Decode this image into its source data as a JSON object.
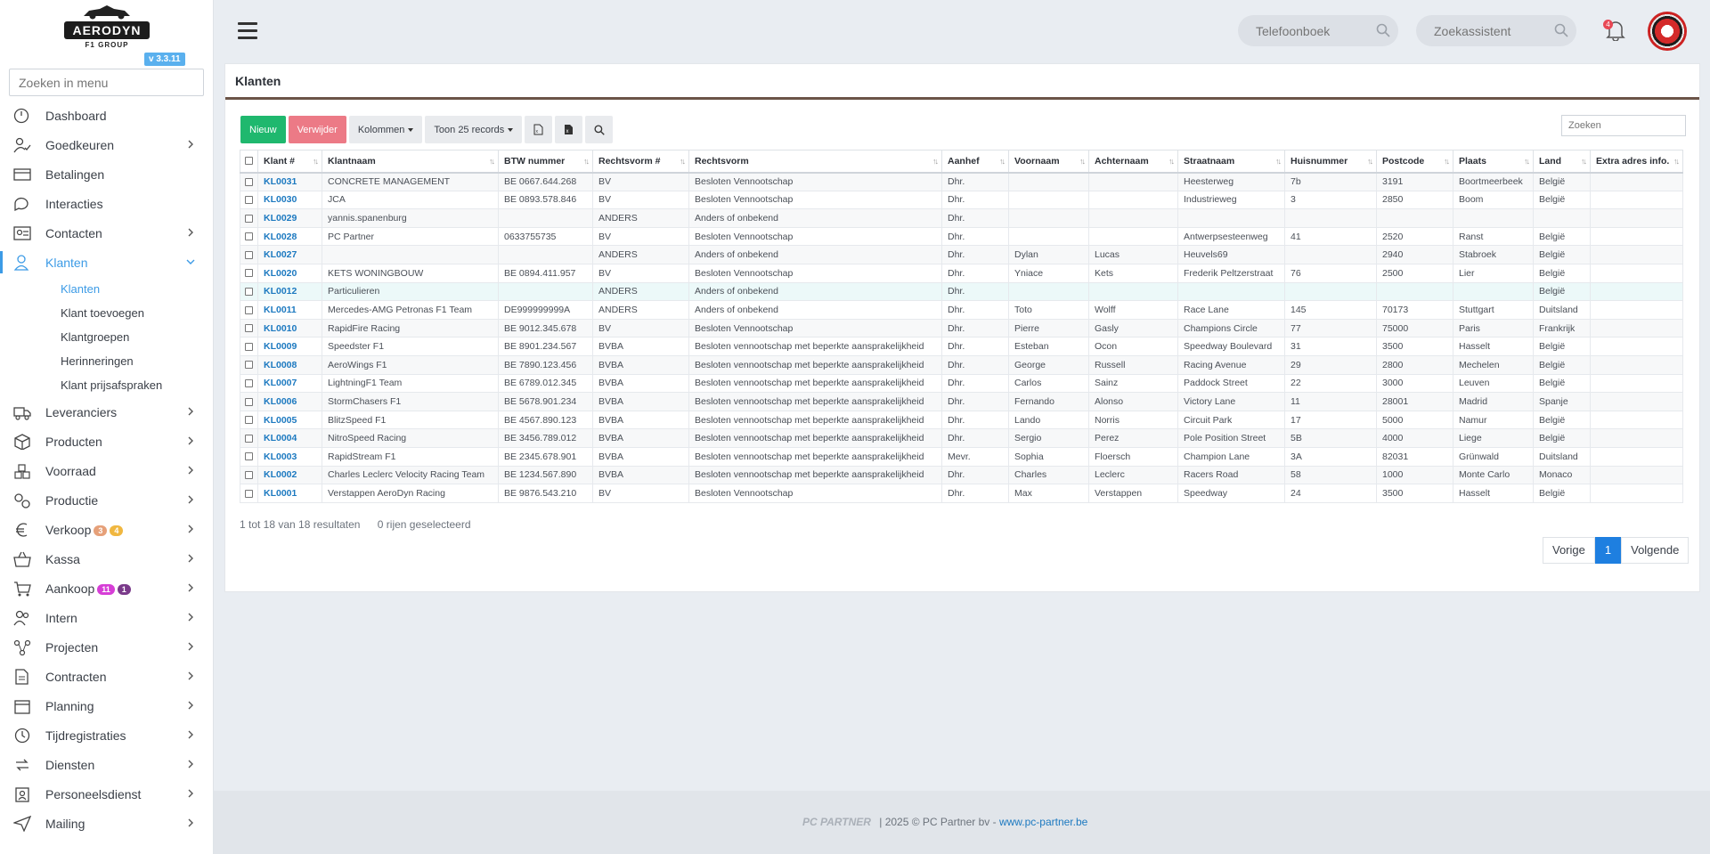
{
  "app": {
    "logo_text": "AERODYN",
    "logo_sub": "F1 GROUP",
    "version": "v 3.3.11"
  },
  "sidebar": {
    "search_placeholder": "Zoeken in menu",
    "items": [
      {
        "label": "Dashboard",
        "icon": "dashboard-icon",
        "chevron": false
      },
      {
        "label": "Goedkeuren",
        "icon": "approve-icon",
        "chevron": true
      },
      {
        "label": "Betalingen",
        "icon": "payments-icon",
        "chevron": false
      },
      {
        "label": "Interacties",
        "icon": "chat-icon",
        "chevron": false
      },
      {
        "label": "Contacten",
        "icon": "contacts-icon",
        "chevron": true
      },
      {
        "label": "Klanten",
        "icon": "user-icon",
        "chevron": true,
        "active": true
      }
    ],
    "sub_items": [
      "Klanten",
      "Klant toevoegen",
      "Klantgroepen",
      "Herinneringen",
      "Klant prijsafspraken"
    ],
    "items_after": [
      {
        "label": "Leveranciers",
        "icon": "truck-icon"
      },
      {
        "label": "Producten",
        "icon": "box-icon"
      },
      {
        "label": "Voorraad",
        "icon": "stock-icon"
      },
      {
        "label": "Productie",
        "icon": "production-icon"
      },
      {
        "label": "Verkoop",
        "icon": "euro-icon",
        "badges": [
          {
            "text": "3",
            "color": "#e6a079"
          },
          {
            "text": "4",
            "color": "#f0b740"
          }
        ]
      },
      {
        "label": "Kassa",
        "icon": "basket-icon"
      },
      {
        "label": "Aankoop",
        "icon": "cart-icon",
        "badges": [
          {
            "text": "11",
            "color": "#d63ed6"
          },
          {
            "text": "1",
            "color": "#7a3a8a"
          }
        ]
      },
      {
        "label": "Intern",
        "icon": "users-icon"
      },
      {
        "label": "Projecten",
        "icon": "projects-icon"
      },
      {
        "label": "Contracten",
        "icon": "contract-icon"
      },
      {
        "label": "Planning",
        "icon": "calendar-icon"
      },
      {
        "label": "Tijdregistraties",
        "icon": "clock-icon"
      },
      {
        "label": "Diensten",
        "icon": "services-icon"
      },
      {
        "label": "Personeelsdienst",
        "icon": "hr-icon"
      },
      {
        "label": "Mailing",
        "icon": "send-icon"
      }
    ]
  },
  "topbar": {
    "phonebook_placeholder": "Telefoonboek",
    "assistant_placeholder": "Zoekassistent",
    "notification_count": "4"
  },
  "page": {
    "title": "Klanten",
    "toolbar": {
      "new_label": "Nieuw",
      "delete_label": "Verwijder",
      "columns_label": "Kolommen",
      "show_label": "Toon 25 records"
    },
    "search_placeholder": "Zoeken",
    "columns": [
      "Klant #",
      "Klantnaam",
      "BTW nummer",
      "Rechtsvorm #",
      "Rechtsvorm",
      "Aanhef",
      "Voornaam",
      "Achternaam",
      "Straatnaam",
      "Huisnummer",
      "Postcode",
      "Plaats",
      "Land",
      "Extra adres info."
    ],
    "rows": [
      [
        "KL0031",
        "CONCRETE MANAGEMENT",
        "BE 0667.644.268",
        "BV",
        "Besloten Vennootschap",
        "Dhr.",
        "",
        "",
        "Heesterweg",
        "7b",
        "3191",
        "Boortmeerbeek",
        "België",
        ""
      ],
      [
        "KL0030",
        "JCA",
        "BE 0893.578.846",
        "BV",
        "Besloten Vennootschap",
        "Dhr.",
        "",
        "",
        "Industrieweg",
        "3",
        "2850",
        "Boom",
        "België",
        ""
      ],
      [
        "KL0029",
        "yannis.spanenburg",
        "",
        "ANDERS",
        "Anders of onbekend",
        "Dhr.",
        "",
        "",
        "",
        "",
        "",
        "",
        "",
        ""
      ],
      [
        "KL0028",
        "PC Partner",
        "0633755735",
        "BV",
        "Besloten Vennootschap",
        "Dhr.",
        "",
        "",
        "Antwerpsesteenweg",
        "41",
        "2520",
        "Ranst",
        "België",
        ""
      ],
      [
        "KL0027",
        "",
        "",
        "ANDERS",
        "Anders of onbekend",
        "Dhr.",
        "Dylan",
        "Lucas",
        "Heuvels69",
        "",
        "2940",
        "Stabroek",
        "België",
        ""
      ],
      [
        "KL0020",
        "KETS WONINGBOUW",
        "BE 0894.411.957",
        "BV",
        "Besloten Vennootschap",
        "Dhr.",
        "Yniace",
        "Kets",
        "Frederik Peltzerstraat",
        "76",
        "2500",
        "Lier",
        "België",
        ""
      ],
      [
        "KL0012",
        "Particulieren",
        "",
        "ANDERS",
        "Anders of onbekend",
        "Dhr.",
        "",
        "",
        "",
        "",
        "",
        "",
        "België",
        ""
      ],
      [
        "KL0011",
        "Mercedes-AMG Petronas F1 Team",
        "DE999999999A",
        "ANDERS",
        "Anders of onbekend",
        "Dhr.",
        "Toto",
        "Wolff",
        "Race Lane",
        "145",
        "70173",
        "Stuttgart",
        "Duitsland",
        ""
      ],
      [
        "KL0010",
        "RapidFire Racing",
        "BE 9012.345.678",
        "BV",
        "Besloten Vennootschap",
        "Dhr.",
        "Pierre",
        "Gasly",
        "Champions Circle",
        "77",
        "75000",
        "Paris",
        "Frankrijk",
        ""
      ],
      [
        "KL0009",
        "Speedster F1",
        "BE 8901.234.567",
        "BVBA",
        "Besloten vennootschap met beperkte aansprakelijkheid",
        "Dhr.",
        "Esteban",
        "Ocon",
        "Speedway Boulevard",
        "31",
        "3500",
        "Hasselt",
        "België",
        ""
      ],
      [
        "KL0008",
        "AeroWings F1",
        "BE 7890.123.456",
        "BVBA",
        "Besloten vennootschap met beperkte aansprakelijkheid",
        "Dhr.",
        "George",
        "Russell",
        "Racing Avenue",
        "29",
        "2800",
        "Mechelen",
        "België",
        ""
      ],
      [
        "KL0007",
        "LightningF1 Team",
        "BE 6789.012.345",
        "BVBA",
        "Besloten vennootschap met beperkte aansprakelijkheid",
        "Dhr.",
        "Carlos",
        "Sainz",
        "Paddock Street",
        "22",
        "3000",
        "Leuven",
        "België",
        ""
      ],
      [
        "KL0006",
        "StormChasers F1",
        "BE 5678.901.234",
        "BVBA",
        "Besloten vennootschap met beperkte aansprakelijkheid",
        "Dhr.",
        "Fernando",
        "Alonso",
        "Victory Lane",
        "11",
        "28001",
        "Madrid",
        "Spanje",
        ""
      ],
      [
        "KL0005",
        "BlitzSpeed F1",
        "BE 4567.890.123",
        "BVBA",
        "Besloten vennootschap met beperkte aansprakelijkheid",
        "Dhr.",
        "Lando",
        "Norris",
        "Circuit Park",
        "17",
        "5000",
        "Namur",
        "België",
        ""
      ],
      [
        "KL0004",
        "NitroSpeed Racing",
        "BE 3456.789.012",
        "BVBA",
        "Besloten vennootschap met beperkte aansprakelijkheid",
        "Dhr.",
        "Sergio",
        "Perez",
        "Pole Position Street",
        "5B",
        "4000",
        "Liege",
        "België",
        ""
      ],
      [
        "KL0003",
        "RapidStream F1",
        "BE 2345.678.901",
        "BVBA",
        "Besloten vennootschap met beperkte aansprakelijkheid",
        "Mevr.",
        "Sophia",
        "Floersch",
        "Champion Lane",
        "3A",
        "82031",
        "Grünwald",
        "Duitsland",
        ""
      ],
      [
        "KL0002",
        "Charles Leclerc Velocity Racing Team",
        "BE 1234.567.890",
        "BVBA",
        "Besloten vennootschap met beperkte aansprakelijkheid",
        "Dhr.",
        "Charles",
        "Leclerc",
        "Racers Road",
        "58",
        "1000",
        "Monte Carlo",
        "Monaco",
        ""
      ],
      [
        "KL0001",
        "Verstappen AeroDyn Racing",
        "BE 9876.543.210",
        "BV",
        "Besloten Vennootschap",
        "Dhr.",
        "Max",
        "Verstappen",
        "Speedway",
        "24",
        "3500",
        "Hasselt",
        "België",
        ""
      ]
    ],
    "highlighted_row": 6,
    "info_results": "1 tot 18 van 18 resultaten",
    "info_selected": "0 rijen geselecteerd",
    "pager": {
      "prev": "Vorige",
      "current": "1",
      "next": "Volgende"
    }
  },
  "footer": {
    "logo": "PC PARTNER",
    "text": "2025 © PC Partner bv - ",
    "link": "www.pc-partner.be"
  }
}
